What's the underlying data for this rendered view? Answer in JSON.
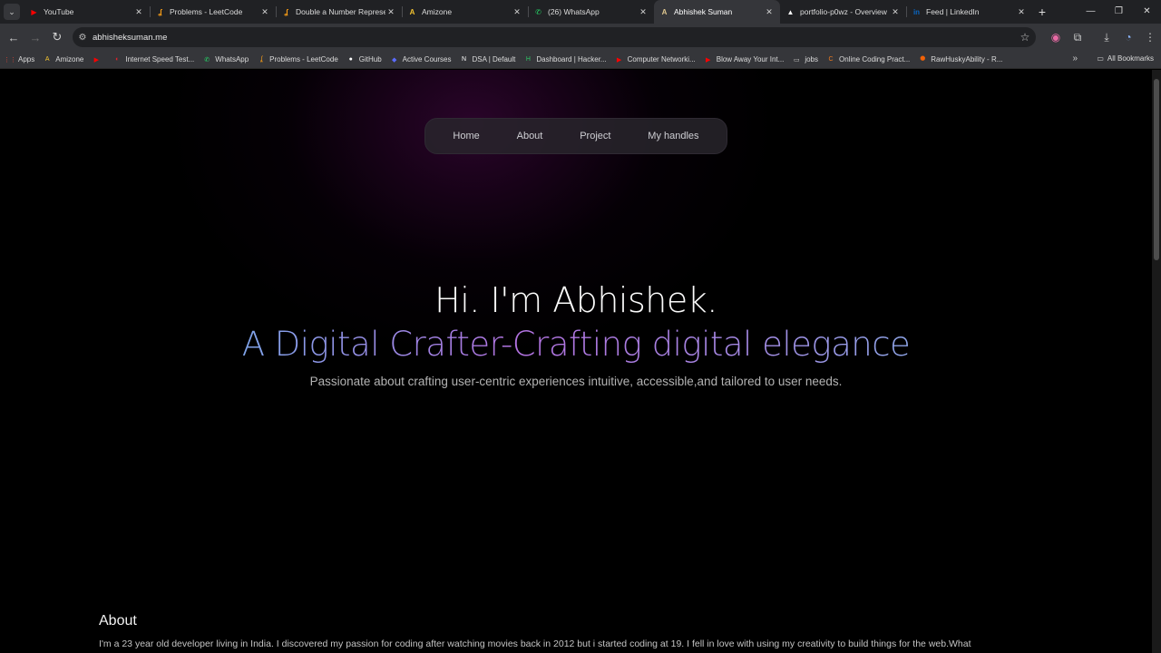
{
  "browser": {
    "tabs": [
      {
        "title": "YouTube",
        "icon": "youtube-icon",
        "color": "#ff0000",
        "glyph": "▶"
      },
      {
        "title": "Problems - LeetCode",
        "icon": "leetcode-icon",
        "color": "#ffa116",
        "glyph": "ʆ"
      },
      {
        "title": "Double a Number Represe",
        "icon": "leetcode-icon",
        "color": "#ffa116",
        "glyph": "ʆ"
      },
      {
        "title": "Amizone",
        "icon": "amizone-icon",
        "color": "#f4c430",
        "glyph": "A"
      },
      {
        "title": "(26) WhatsApp",
        "icon": "whatsapp-icon",
        "color": "#25d366",
        "glyph": "✆"
      },
      {
        "title": "Abhishek Suman",
        "icon": "portfolio-icon",
        "color": "#e0c890",
        "glyph": "A",
        "active": true
      },
      {
        "title": "portfolio-p0wz - Overview",
        "icon": "vercel-icon",
        "color": "#ffffff",
        "glyph": "▲"
      },
      {
        "title": "Feed | LinkedIn",
        "icon": "linkedin-icon",
        "color": "#0a66c2",
        "glyph": "in"
      }
    ],
    "url": "abhisheksuman.me",
    "bookmarks": [
      {
        "label": "Apps",
        "icon": "apps-grid-icon",
        "color": "#ea4335",
        "glyph": "⋮⋮"
      },
      {
        "label": "Amizone",
        "icon": "amizone-icon",
        "color": "#f4c430",
        "glyph": "A"
      },
      {
        "label": "",
        "icon": "youtube-icon",
        "color": "#ff0000",
        "glyph": "▶"
      },
      {
        "label": "Internet Speed Test...",
        "icon": "speedtest-icon",
        "color": "#e5212b",
        "glyph": "◐"
      },
      {
        "label": "WhatsApp",
        "icon": "whatsapp-icon",
        "color": "#25d366",
        "glyph": "✆"
      },
      {
        "label": "Problems - LeetCode",
        "icon": "leetcode-icon",
        "color": "#ffa116",
        "glyph": "ʆ"
      },
      {
        "label": "GitHub",
        "icon": "github-icon",
        "color": "#ffffff",
        "glyph": "●"
      },
      {
        "label": "Active Courses",
        "icon": "courses-icon",
        "color": "#5b6cff",
        "glyph": "◆"
      },
      {
        "label": "DSA | Default",
        "icon": "notion-icon",
        "color": "#ffffff",
        "glyph": "N"
      },
      {
        "label": "Dashboard | Hacker...",
        "icon": "hackerrank-icon",
        "color": "#2ec866",
        "glyph": "H"
      },
      {
        "label": "Computer Networki...",
        "icon": "youtube-icon",
        "color": "#ff0000",
        "glyph": "▶"
      },
      {
        "label": "Blow Away Your Int...",
        "icon": "youtube-icon",
        "color": "#ff0000",
        "glyph": "▶"
      },
      {
        "label": "jobs",
        "icon": "folder-icon",
        "color": "#cccccc",
        "glyph": "▭"
      },
      {
        "label": "Online Coding Pract...",
        "icon": "codingninjas-icon",
        "color": "#f07b20",
        "glyph": "C"
      },
      {
        "label": "RawHuskyAbility - R...",
        "icon": "replit-icon",
        "color": "#f26207",
        "glyph": "⯃"
      }
    ],
    "all_bookmarks": "All Bookmarks"
  },
  "site": {
    "nav": [
      "Home",
      "About",
      "Project",
      "My handles"
    ],
    "hero_title": "Hi. I'm Abhishek.",
    "hero_subtitle": "A Digital Crafter-Crafting digital elegance",
    "hero_tagline": "Passionate about crafting user-centric experiences intuitive, accessible,and tailored to user needs.",
    "about_title": "About",
    "about_text": "I'm a 23 year old developer living in India. I discovered my passion for coding after watching movies back in 2012 but i started coding at 19. I fell in love with using my creativity to build things for the web.What"
  }
}
